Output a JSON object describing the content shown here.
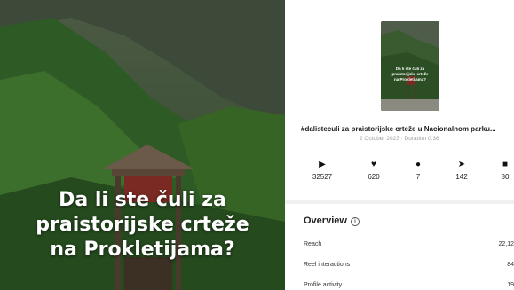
{
  "headline": {
    "line1": "Da li ste čuli za",
    "line2": "praistorijske crteže",
    "line3": "na Prokletijama?"
  },
  "thumbnail": {
    "caption_line1": "Da li ste čuli za",
    "caption_line2": "praistorijske crteže",
    "caption_line3": "na Prokletijama?"
  },
  "post": {
    "title": "#dalisteculi za praistorijske crteže u Nacionalnom parku...",
    "meta": "2 October 2023 · Duration 0:36"
  },
  "stats": [
    {
      "icon": "play-icon",
      "value": "32527"
    },
    {
      "icon": "heart-icon",
      "value": "620"
    },
    {
      "icon": "comment-icon",
      "value": "7"
    },
    {
      "icon": "share-icon",
      "value": "142"
    },
    {
      "icon": "bookmark-icon",
      "value": "80"
    }
  ],
  "overview": {
    "title": "Overview",
    "rows": [
      {
        "label": "Reach",
        "value": "22,12"
      },
      {
        "label": "Reel interactions",
        "value": "84"
      },
      {
        "label": "Profile activity",
        "value": "19"
      }
    ]
  }
}
